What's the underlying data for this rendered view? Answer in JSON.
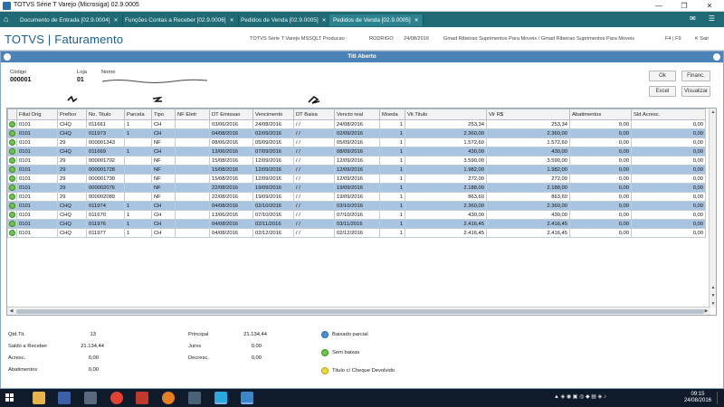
{
  "window": {
    "title": "TOTVS Série T Varejo (Microsiga) 02.9.0005",
    "minimize": "—",
    "maximize": "❐",
    "close": "✕"
  },
  "tabs": [
    {
      "label": "Documento de Entrada [02.9.0004]",
      "active": false
    },
    {
      "label": "Funções Contas a Receber [02.9.0006]",
      "active": false
    },
    {
      "label": "Pedidos de Venda [02.9.0005]",
      "active": false
    },
    {
      "label": "Pedidos de Venda [02.9.0005]",
      "active": true
    }
  ],
  "app_header": {
    "brand": "TOTVS | Faturamento",
    "environment": "TOTVS Série T Varejo MSSQLT Producao",
    "user": "RODRIGO",
    "date": "24/08/2016",
    "company": "Gmad Ribeirao Suprimentos Para Moveis / Gmad Ribeirao Suprimentos Para Moveis",
    "shortcut": "F4 | F9",
    "exit": "✕ Sair"
  },
  "dialog": {
    "title": "Titl Aberto",
    "codigo_label": "Código",
    "codigo_value": "000001",
    "loja_label": "Loja",
    "loja_value": "01",
    "nome_label": "Nome",
    "buttons": {
      "ok": "Ok",
      "financ": "Financ.",
      "excel": "Excel",
      "visualizar": "Visualizar"
    }
  },
  "grid": {
    "columns": [
      "",
      "Filial Orig",
      "Prefixo",
      "No. Titulo",
      "Parcela",
      "Tipo",
      "NF Eletr",
      "DT Emissao",
      "Vencimento",
      "DT Baixa",
      "Vencto real",
      "Moeda",
      "Vlr.Titulo",
      "Vlr R$",
      "Abatimentos",
      "Sld.Acresc."
    ],
    "rows": [
      {
        "filial": "0101",
        "prefixo": "CHQ",
        "titulo": "011661",
        "parcela": "1",
        "tipo": "CH",
        "nf": "",
        "emissao": "03/06/2016",
        "vencimento": "24/08/2016",
        "baixa": "/ /",
        "vencto_real": "24/08/2016",
        "moeda": "1",
        "vlr_titulo": "253,34",
        "vlr_rs": "253,34",
        "abatimentos": "0,00",
        "sld": "0,00",
        "hl": false
      },
      {
        "filial": "0101",
        "prefixo": "CHQ",
        "titulo": "011973",
        "parcela": "1",
        "tipo": "CH",
        "nf": "",
        "emissao": "04/08/2016",
        "vencimento": "02/09/2016",
        "baixa": "/ /",
        "vencto_real": "02/09/2016",
        "moeda": "1",
        "vlr_titulo": "2.360,00",
        "vlr_rs": "2.360,00",
        "abatimentos": "0,00",
        "sld": "0,00",
        "hl": true
      },
      {
        "filial": "0101",
        "prefixo": "29",
        "titulo": "000001343",
        "parcela": "",
        "tipo": "NF",
        "nf": "",
        "emissao": "08/06/2016",
        "vencimento": "05/09/2016",
        "baixa": "/ /",
        "vencto_real": "05/09/2016",
        "moeda": "1",
        "vlr_titulo": "1.572,60",
        "vlr_rs": "1.572,60",
        "abatimentos": "0,00",
        "sld": "0,00",
        "hl": false
      },
      {
        "filial": "0101",
        "prefixo": "CHQ",
        "titulo": "011669",
        "parcela": "1",
        "tipo": "CH",
        "nf": "",
        "emissao": "13/06/2016",
        "vencimento": "07/09/2016",
        "baixa": "/ /",
        "vencto_real": "08/09/2016",
        "moeda": "1",
        "vlr_titulo": "430,00",
        "vlr_rs": "430,00",
        "abatimentos": "0,00",
        "sld": "0,00",
        "hl": true
      },
      {
        "filial": "0101",
        "prefixo": "29",
        "titulo": "000001702",
        "parcela": "",
        "tipo": "NF",
        "nf": "",
        "emissao": "15/08/2016",
        "vencimento": "12/09/2016",
        "baixa": "/ /",
        "vencto_real": "12/09/2016",
        "moeda": "1",
        "vlr_titulo": "3.590,00",
        "vlr_rs": "3.590,00",
        "abatimentos": "0,00",
        "sld": "0,00",
        "hl": false
      },
      {
        "filial": "0101",
        "prefixo": "29",
        "titulo": "000001728",
        "parcela": "",
        "tipo": "NF",
        "nf": "",
        "emissao": "15/08/2016",
        "vencimento": "12/09/2016",
        "baixa": "/ /",
        "vencto_real": "12/09/2016",
        "moeda": "1",
        "vlr_titulo": "1.982,00",
        "vlr_rs": "1.982,00",
        "abatimentos": "0,00",
        "sld": "0,00",
        "hl": true
      },
      {
        "filial": "0101",
        "prefixo": "29",
        "titulo": "000001730",
        "parcela": "",
        "tipo": "NF",
        "nf": "",
        "emissao": "15/08/2016",
        "vencimento": "12/09/2016",
        "baixa": "/ /",
        "vencto_real": "12/09/2016",
        "moeda": "1",
        "vlr_titulo": "272,00",
        "vlr_rs": "272,00",
        "abatimentos": "0,00",
        "sld": "0,00",
        "hl": false
      },
      {
        "filial": "0101",
        "prefixo": "29",
        "titulo": "000002076",
        "parcela": "",
        "tipo": "NF",
        "nf": "",
        "emissao": "22/08/2016",
        "vencimento": "19/09/2016",
        "baixa": "/ /",
        "vencto_real": "19/09/2016",
        "moeda": "1",
        "vlr_titulo": "2.188,00",
        "vlr_rs": "2.188,00",
        "abatimentos": "0,00",
        "sld": "0,00",
        "hl": true
      },
      {
        "filial": "0101",
        "prefixo": "29",
        "titulo": "000002089",
        "parcela": "",
        "tipo": "NF",
        "nf": "",
        "emissao": "22/08/2016",
        "vencimento": "19/09/2016",
        "baixa": "/ /",
        "vencto_real": "19/09/2016",
        "moeda": "1",
        "vlr_titulo": "863,60",
        "vlr_rs": "863,60",
        "abatimentos": "0,00",
        "sld": "0,00",
        "hl": false
      },
      {
        "filial": "0101",
        "prefixo": "CHQ",
        "titulo": "011974",
        "parcela": "1",
        "tipo": "CH",
        "nf": "",
        "emissao": "04/08/2016",
        "vencimento": "02/10/2016",
        "baixa": "/ /",
        "vencto_real": "03/10/2016",
        "moeda": "1",
        "vlr_titulo": "2.360,00",
        "vlr_rs": "2.360,00",
        "abatimentos": "0,00",
        "sld": "0,00",
        "hl": true
      },
      {
        "filial": "0101",
        "prefixo": "CHQ",
        "titulo": "011670",
        "parcela": "1",
        "tipo": "CH",
        "nf": "",
        "emissao": "13/06/2016",
        "vencimento": "07/10/2016",
        "baixa": "/ /",
        "vencto_real": "07/10/2016",
        "moeda": "1",
        "vlr_titulo": "430,00",
        "vlr_rs": "430,00",
        "abatimentos": "0,00",
        "sld": "0,00",
        "hl": false
      },
      {
        "filial": "0101",
        "prefixo": "CHQ",
        "titulo": "011976",
        "parcela": "1",
        "tipo": "CH",
        "nf": "",
        "emissao": "04/08/2016",
        "vencimento": "02/11/2016",
        "baixa": "/ /",
        "vencto_real": "03/11/2016",
        "moeda": "1",
        "vlr_titulo": "2.416,45",
        "vlr_rs": "2.416,45",
        "abatimentos": "0,00",
        "sld": "0,00",
        "hl": true
      },
      {
        "filial": "0101",
        "prefixo": "CHQ",
        "titulo": "011977",
        "parcela": "1",
        "tipo": "CH",
        "nf": "",
        "emissao": "04/08/2016",
        "vencimento": "02/12/2016",
        "baixa": "/ /",
        "vencto_real": "02/12/2016",
        "moeda": "1",
        "vlr_titulo": "2.416,45",
        "vlr_rs": "2.416,45",
        "abatimentos": "0,00",
        "sld": "0,00",
        "hl": false
      }
    ]
  },
  "totals": {
    "qtd_label": "Qtd.Tit.",
    "qtd_value": "13",
    "saldo_label": "Saldo a Receber",
    "saldo_value": "21.134,44",
    "acresc_label": "Acresc.",
    "acresc_value": "0,00",
    "abat_label": "Abatimentos",
    "abat_value": "0,00",
    "principal_label": "Principal",
    "principal_value": "21.134,44",
    "juros_label": "Juros",
    "juros_value": "0,00",
    "decresc_label": "Decresc.",
    "decresc_value": "0,00"
  },
  "legend": [
    {
      "label": "Baixado parcial",
      "color": "#4a90d9"
    },
    {
      "label": "Sem baixas",
      "color": "#6dc64a"
    },
    {
      "label": "Titulo c/ Cheque Devolvido",
      "color": "#f0d830"
    }
  ],
  "taskbar": {
    "time": "09:15",
    "date": "24/08/2016"
  },
  "colors": {
    "tabbar": "#1f6a75",
    "dialog_title": "#4b82b8",
    "row_highlight": "#a9c4e0",
    "status_green": "#6dc64a"
  }
}
